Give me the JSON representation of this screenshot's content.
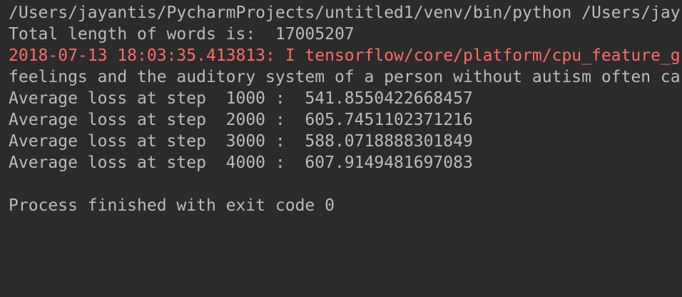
{
  "console": {
    "lines": [
      {
        "text": "/Users/jayantis/PycharmProjects/untitled1/venv/bin/python /Users/jay",
        "kind": "normal"
      },
      {
        "text": "Total length of words is:  17005207",
        "kind": "normal"
      },
      {
        "text": "2018-07-13 18:03:35.413813: I tensorflow/core/platform/cpu_feature_g",
        "kind": "error"
      },
      {
        "text": "feelings and the auditory system of a person without autism often ca",
        "kind": "normal"
      },
      {
        "text": "Average loss at step  1000 :  541.8550422668457",
        "kind": "normal"
      },
      {
        "text": "Average loss at step  2000 :  605.7451102371216",
        "kind": "normal"
      },
      {
        "text": "Average loss at step  3000 :  588.0718888301849",
        "kind": "normal"
      },
      {
        "text": "Average loss at step  4000 :  607.9149481697083",
        "kind": "normal"
      },
      {
        "text": "",
        "kind": "normal"
      },
      {
        "text": "Process finished with exit code 0",
        "kind": "normal"
      }
    ]
  },
  "colors": {
    "background": "#2b2b2b",
    "normal_text": "#bbbbbb",
    "error_text": "#ff6b68"
  }
}
